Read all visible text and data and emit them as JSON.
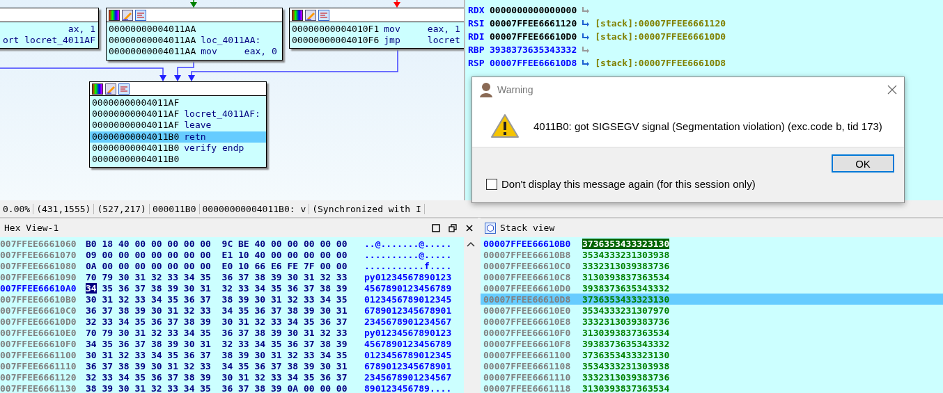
{
  "graph": {
    "nodes": [
      {
        "lines": [
          {
            "code": "ax, 1",
            "selected": false
          },
          {
            "code": "ort locret_4011AF",
            "selected": false
          }
        ]
      },
      {
        "lines": [
          {
            "address": "00000000004011AA",
            "selected": false
          },
          {
            "address": "00000000004011AA",
            "code": "loc_4011AA:",
            "selected": false
          },
          {
            "address": "00000000004011AA",
            "code": "mov     eax, 0",
            "selected": false
          }
        ]
      },
      {
        "lines": [
          {
            "address": "00000000004010F1",
            "code": "mov     eax, 1",
            "selected": false
          },
          {
            "address": "00000000004010F6",
            "code": "jmp     locret",
            "selected": false
          }
        ]
      },
      {
        "lines": [
          {
            "address": "00000000004011AF",
            "selected": false
          },
          {
            "address": "00000000004011AF",
            "code": "locret_4011AF:",
            "selected": false
          },
          {
            "address": "00000000004011AF",
            "code": "leave",
            "selected": false
          },
          {
            "address": "00000000004011B0",
            "code": "retn",
            "selected": true
          },
          {
            "address": "00000000004011B0",
            "code": "verify endp",
            "selected": false
          },
          {
            "address": "00000000004011B0",
            "selected": false
          }
        ]
      }
    ]
  },
  "registers": [
    {
      "name": "RDX",
      "value": "0000000000000000",
      "changed": false
    },
    {
      "name": "RSI",
      "value": "00007FFEE6661120",
      "ref": "[stack]:00007FFEE6661120",
      "changed": false
    },
    {
      "name": "RDI",
      "value": "00007FFEE66610D0",
      "ref": "[stack]:00007FFEE66610D0",
      "changed": false
    },
    {
      "name": "RBP",
      "value": "3938373635343332",
      "changed": true
    },
    {
      "name": "RSP",
      "value": "00007FFEE66610D8",
      "ref": "[stack]:00007FFEE66610D8",
      "changed": true
    }
  ],
  "status_bar": [
    "0.00%",
    "(431,1555)",
    "(527,217)",
    "000011B0",
    "00000000004011B0: v",
    "(Synchronized with I"
  ],
  "hex_view": {
    "title": "Hex View-1",
    "rows": [
      {
        "address": "007FFEE6661060",
        "cursor_byte": "",
        "bytes": [
          "B0",
          "18",
          "40",
          "00",
          "00",
          "00",
          "00",
          "00",
          "9C",
          "BE",
          "40",
          "00",
          "00",
          "00",
          "00",
          "00"
        ],
        "ascii": "..@.......@.....",
        "selected": false
      },
      {
        "address": "007FFEE6661070",
        "cursor_byte": "",
        "bytes": [
          "09",
          "00",
          "00",
          "00",
          "00",
          "00",
          "00",
          "00",
          "E1",
          "10",
          "40",
          "00",
          "00",
          "00",
          "00",
          "00"
        ],
        "ascii": "..........@.....",
        "selected": false
      },
      {
        "address": "007FFEE6661080",
        "cursor_byte": "",
        "bytes": [
          "0A",
          "00",
          "00",
          "00",
          "00",
          "00",
          "00",
          "00",
          "E0",
          "10",
          "66",
          "E6",
          "FE",
          "7F",
          "00",
          "00"
        ],
        "ascii": "...........f....",
        "selected": false
      },
      {
        "address": "007FFEE6661090",
        "cursor_byte": "",
        "bytes": [
          "70",
          "79",
          "30",
          "31",
          "32",
          "33",
          "34",
          "35",
          "36",
          "37",
          "38",
          "39",
          "30",
          "31",
          "32",
          "33"
        ],
        "ascii": "py01234567890123",
        "selected": false
      },
      {
        "address": "007FFEE66610A0",
        "cursor_byte": "34",
        "bytes": [
          "35",
          "36",
          "37",
          "38",
          "39",
          "30",
          "31",
          "32",
          "33",
          "34",
          "35",
          "36",
          "37",
          "38",
          "39"
        ],
        "ascii": "4567890123456789",
        "selected": true
      },
      {
        "address": "007FFEE66610B0",
        "cursor_byte": "",
        "bytes": [
          "30",
          "31",
          "32",
          "33",
          "34",
          "35",
          "36",
          "37",
          "38",
          "39",
          "30",
          "31",
          "32",
          "33",
          "34",
          "35"
        ],
        "ascii": "0123456789012345",
        "selected": false
      },
      {
        "address": "007FFEE66610C0",
        "cursor_byte": "",
        "bytes": [
          "36",
          "37",
          "38",
          "39",
          "30",
          "31",
          "32",
          "33",
          "34",
          "35",
          "36",
          "37",
          "38",
          "39",
          "30",
          "31"
        ],
        "ascii": "6789012345678901",
        "selected": false
      },
      {
        "address": "007FFEE66610D0",
        "cursor_byte": "",
        "bytes": [
          "32",
          "33",
          "34",
          "35",
          "36",
          "37",
          "38",
          "39",
          "30",
          "31",
          "32",
          "33",
          "34",
          "35",
          "36",
          "37"
        ],
        "ascii": "2345678901234567",
        "selected": false
      },
      {
        "address": "007FFEE66610E0",
        "cursor_byte": "",
        "bytes": [
          "70",
          "79",
          "30",
          "31",
          "32",
          "33",
          "34",
          "35",
          "36",
          "37",
          "38",
          "39",
          "30",
          "31",
          "32",
          "33"
        ],
        "ascii": "py01234567890123",
        "selected": false
      },
      {
        "address": "007FFEE66610F0",
        "cursor_byte": "",
        "bytes": [
          "34",
          "35",
          "36",
          "37",
          "38",
          "39",
          "30",
          "31",
          "32",
          "33",
          "34",
          "35",
          "36",
          "37",
          "38",
          "39"
        ],
        "ascii": "4567890123456789",
        "selected": false
      },
      {
        "address": "007FFEE6661100",
        "cursor_byte": "",
        "bytes": [
          "30",
          "31",
          "32",
          "33",
          "34",
          "35",
          "36",
          "37",
          "38",
          "39",
          "30",
          "31",
          "32",
          "33",
          "34",
          "35"
        ],
        "ascii": "0123456789012345",
        "selected": false
      },
      {
        "address": "007FFEE6661110",
        "cursor_byte": "",
        "bytes": [
          "36",
          "37",
          "38",
          "39",
          "30",
          "31",
          "32",
          "33",
          "34",
          "35",
          "36",
          "37",
          "38",
          "39",
          "30",
          "31"
        ],
        "ascii": "6789012345678901",
        "selected": false
      },
      {
        "address": "007FFEE6661120",
        "cursor_byte": "",
        "bytes": [
          "32",
          "33",
          "34",
          "35",
          "36",
          "37",
          "38",
          "39",
          "30",
          "31",
          "32",
          "33",
          "34",
          "35",
          "36",
          "37"
        ],
        "ascii": "2345678901234567",
        "selected": false
      },
      {
        "address": "007FFEE6661130",
        "cursor_byte": "",
        "bytes": [
          "38",
          "39",
          "30",
          "31",
          "32",
          "33",
          "34",
          "35",
          "36",
          "37",
          "38",
          "39",
          "0A",
          "00",
          "00",
          "00"
        ],
        "ascii": "890123456789....",
        "selected": false
      }
    ]
  },
  "stack_view": {
    "title": "Stack view",
    "rows": [
      {
        "address": "00007FFEE66610B0",
        "value": "3736353433323130",
        "top": true,
        "selected": false
      },
      {
        "address": "00007FFEE66610B8",
        "value": "3534333231303938",
        "top": false,
        "selected": false
      },
      {
        "address": "00007FFEE66610C0",
        "value": "3332313039383736",
        "top": false,
        "selected": false
      },
      {
        "address": "00007FFEE66610C8",
        "value": "3130393837363534",
        "top": false,
        "selected": false
      },
      {
        "address": "00007FFEE66610D0",
        "value": "3938373635343332",
        "top": false,
        "selected": false
      },
      {
        "address": "00007FFEE66610D8",
        "value": "3736353433323130",
        "top": false,
        "selected": true
      },
      {
        "address": "00007FFEE66610E0",
        "value": "3534333231307970",
        "top": false,
        "selected": false
      },
      {
        "address": "00007FFEE66610E8",
        "value": "3332313039383736",
        "top": false,
        "selected": false
      },
      {
        "address": "00007FFEE66610F0",
        "value": "3130393837363534",
        "top": false,
        "selected": false
      },
      {
        "address": "00007FFEE66610F8",
        "value": "3938373635343332",
        "top": false,
        "selected": false
      },
      {
        "address": "00007FFEE6661100",
        "value": "3736353433323130",
        "top": false,
        "selected": false
      },
      {
        "address": "00007FFEE6661108",
        "value": "3534333231303938",
        "top": false,
        "selected": false
      },
      {
        "address": "00007FFEE6661110",
        "value": "3332313039383736",
        "top": false,
        "selected": false
      },
      {
        "address": "00007FFEE6661118",
        "value": "3130393837363534",
        "top": false,
        "selected": false
      }
    ]
  },
  "dialog": {
    "title": "Warning",
    "message": "4011B0: got SIGSEGV signal (Segmentation violation) (exc.code b, tid 173)",
    "button": "OK",
    "checkbox": {
      "label": "Don't display this message again (for this session only)",
      "checked": false
    }
  }
}
